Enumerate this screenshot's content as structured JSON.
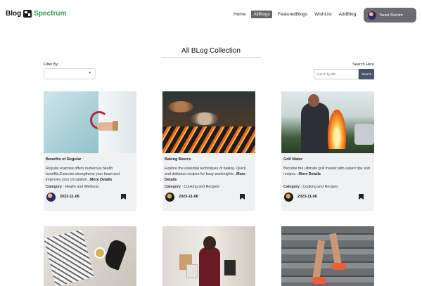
{
  "nav": {
    "brand_blog": "Blog",
    "brand_spectrum": "Spectrum",
    "links": [
      {
        "label": "Home",
        "active": false
      },
      {
        "label": "AllBlogs",
        "active": true
      },
      {
        "label": "FeaturedBlogs",
        "active": false
      },
      {
        "label": "WishList",
        "active": false
      },
      {
        "label": "AddBlog",
        "active": false
      }
    ],
    "user_name": "Tanvir Ramim"
  },
  "main": {
    "title": "All BLog Collection",
    "filter_label": "Filter By:",
    "filter_value": "",
    "search_label": "Search Here",
    "search_placeholder": "search by title",
    "search_button": "Search"
  },
  "cards": [
    {
      "title": "Benefits of Regular",
      "description": "Regular exercise offers numerous health benefits.Exercise strengthens your heart and improves your circulation...",
      "more": "More Details",
      "category_label": "Category",
      "category": "Health and Wellness",
      "date": "2023-11-06"
    },
    {
      "title": "Baking Basics",
      "description": "Explore the essential techniques of baking. Quick and delicious recipes for busy weeknights...",
      "more": "More Details",
      "category_label": "Category",
      "category": "Cooking and Recipes",
      "date": "2023-11-06"
    },
    {
      "title": "Grill Mater",
      "description": "Become the ultimate grill master with expert tips and recipes...",
      "more": "More Details",
      "category_label": "Category",
      "category": "Cooking and Recipes",
      "date": "2023-11-06"
    }
  ]
}
